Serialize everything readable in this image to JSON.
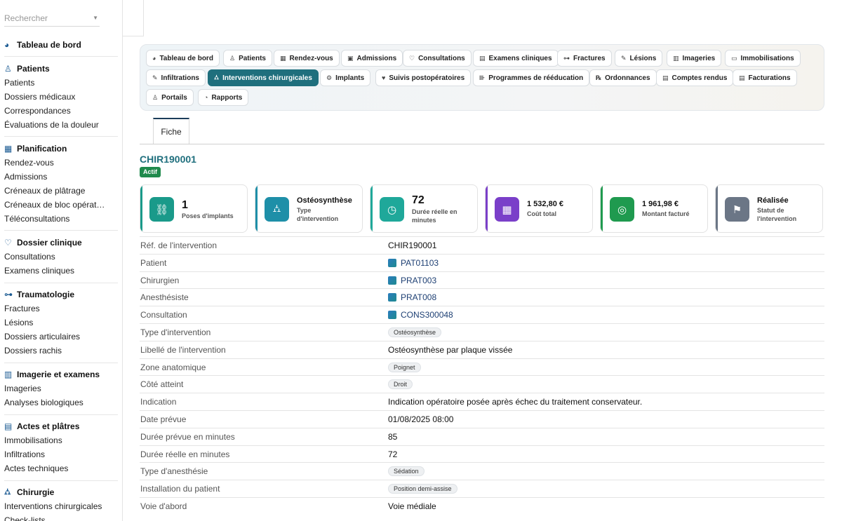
{
  "search": {
    "placeholder": "Rechercher"
  },
  "sidebar": {
    "dashboard": "Tableau de bord",
    "groups": [
      {
        "title": "Patients",
        "icon": "person-icon",
        "items": [
          "Patients",
          "Dossiers médicaux",
          "Correspondances",
          "Évaluations de la douleur"
        ]
      },
      {
        "title": "Planification",
        "icon": "calendar-icon",
        "items": [
          "Rendez-vous",
          "Admissions",
          "Créneaux de plâtrage",
          "Créneaux de bloc opérat…",
          "Téléconsultations"
        ]
      },
      {
        "title": "Dossier clinique",
        "icon": "stethoscope-icon",
        "items": [
          "Consultations",
          "Examens cliniques"
        ]
      },
      {
        "title": "Traumatologie",
        "icon": "bone-icon",
        "items": [
          "Fractures",
          "Lésions",
          "Dossiers articulaires",
          "Dossiers rachis"
        ]
      },
      {
        "title": "Imagerie et examens",
        "icon": "xray-icon",
        "items": [
          "Imageries",
          "Analyses biologiques"
        ]
      },
      {
        "title": "Actes et plâtres",
        "icon": "bandage-icon",
        "items": [
          "Immobilisations",
          "Infiltrations",
          "Actes techniques"
        ]
      },
      {
        "title": "Chirurgie",
        "icon": "bed-icon",
        "items": [
          "Interventions chirurgicales",
          "Check-lists"
        ]
      }
    ]
  },
  "nav": {
    "buttons": [
      {
        "label": "Tableau de bord",
        "icon": "gauge-icon"
      },
      {
        "label": "Patients",
        "icon": "person-icon"
      },
      {
        "label": "Rendez-vous",
        "icon": "calendar-icon"
      },
      {
        "label": "Admissions",
        "icon": "clipboard-icon"
      },
      {
        "label": "Consultations",
        "icon": "stethoscope-icon"
      },
      {
        "label": "Examens cliniques",
        "icon": "file-medical-icon"
      },
      {
        "label": "Fractures",
        "icon": "bone-icon"
      },
      {
        "label": "Lésions",
        "icon": "bandage-icon"
      },
      {
        "label": "Imageries",
        "icon": "xray-icon"
      },
      {
        "label": "Immobilisations",
        "icon": "splint-icon"
      },
      {
        "label": "Infiltrations",
        "icon": "syringe-icon"
      },
      {
        "label": "Interventions chirurgicales",
        "icon": "bed-icon"
      },
      {
        "label": "Implants",
        "icon": "gears-icon"
      },
      {
        "label": "Suivis postopératoires",
        "icon": "heart-icon"
      },
      {
        "label": "Programmes de rééducation",
        "icon": "dumbbell-icon"
      },
      {
        "label": "Ordonnances",
        "icon": "prescription-icon"
      },
      {
        "label": "Comptes rendus",
        "icon": "document-icon"
      },
      {
        "label": "Facturations",
        "icon": "invoice-icon"
      },
      {
        "label": "Portails",
        "icon": "users-icon"
      },
      {
        "label": "Rapports",
        "icon": "pie-chart-icon"
      }
    ],
    "active": "Interventions chirurgicales"
  },
  "tabs": {
    "fiche": "Fiche"
  },
  "record": {
    "id": "CHIR190001",
    "status_badge": "Actif"
  },
  "cards": [
    {
      "value": "1",
      "label": "Poses d'implants",
      "color": "#1a9a8a",
      "icon": "link-icon"
    },
    {
      "value": "Ostéosynthèse",
      "label": "Type d'intervention",
      "color": "#1e8fa8",
      "icon": "bed-icon"
    },
    {
      "value": "72",
      "label": "Durée réelle en minutes",
      "color": "#1fa89a",
      "icon": "clock-icon"
    },
    {
      "value": "1 532,80 €",
      "label": "Coût total",
      "color": "#7a3fc9",
      "icon": "calculator-icon"
    },
    {
      "value": "1 961,98 €",
      "label": "Montant facturé",
      "color": "#1f9a4f",
      "icon": "coins-icon"
    },
    {
      "value": "Réalisée",
      "label": "Statut de l'intervention",
      "color": "#6b7686",
      "icon": "flag-icon"
    }
  ],
  "fields": [
    {
      "label": "Réf. de l'intervention",
      "value": "CHIR190001",
      "kind": "text"
    },
    {
      "label": "Patient",
      "value": "PAT01103",
      "kind": "link"
    },
    {
      "label": "Chirurgien",
      "value": "PRAT003",
      "kind": "link"
    },
    {
      "label": "Anesthésiste",
      "value": "PRAT008",
      "kind": "link"
    },
    {
      "label": "Consultation",
      "value": "CONS300048",
      "kind": "link"
    },
    {
      "label": "Type d'intervention",
      "value": "Ostéosynthèse",
      "kind": "pill"
    },
    {
      "label": "Libellé de l'intervention",
      "value": "Ostéosynthèse par plaque vissée",
      "kind": "text"
    },
    {
      "label": "Zone anatomique",
      "value": "Poignet",
      "kind": "pill"
    },
    {
      "label": "Côté atteint",
      "value": "Droit",
      "kind": "pill"
    },
    {
      "label": "Indication",
      "value": "Indication opératoire posée après échec du traitement conservateur.",
      "kind": "text"
    },
    {
      "label": "Date prévue",
      "value": "01/08/2025 08:00",
      "kind": "text"
    },
    {
      "label": "Durée prévue en minutes",
      "value": "85",
      "kind": "text"
    },
    {
      "label": "Durée réelle en minutes",
      "value": "72",
      "kind": "text"
    },
    {
      "label": "Type d'anesthésie",
      "value": "Sédation",
      "kind": "pill"
    },
    {
      "label": "Installation du patient",
      "value": "Position demi-assise",
      "kind": "pill"
    },
    {
      "label": "Voie d'abord",
      "value": "Voie médiale",
      "kind": "text"
    }
  ]
}
